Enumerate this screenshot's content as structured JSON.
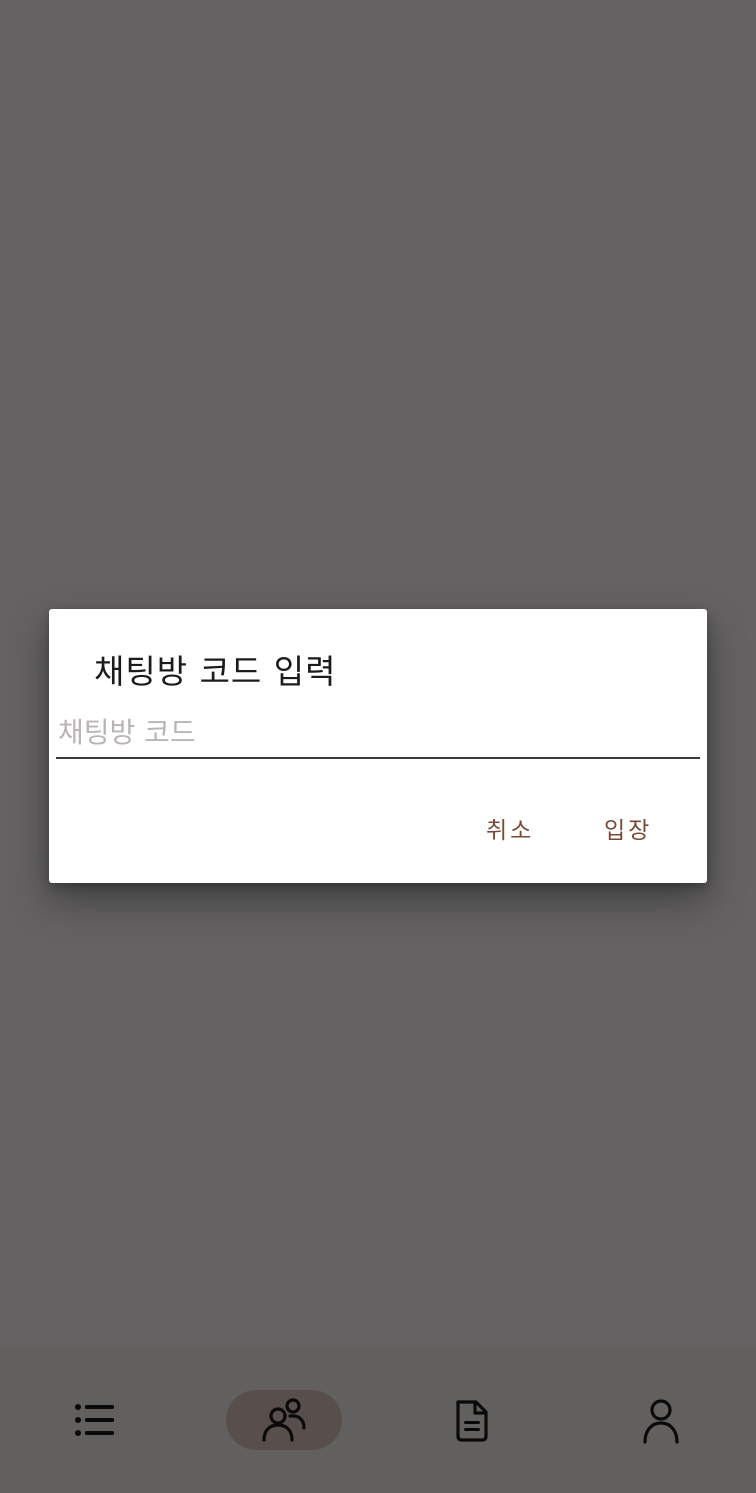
{
  "bottom_nav": {
    "items": [
      {
        "icon": "list-icon",
        "active": false
      },
      {
        "icon": "people-icon",
        "active": true
      },
      {
        "icon": "document-icon",
        "active": false
      },
      {
        "icon": "person-icon",
        "active": false
      }
    ]
  },
  "dialog": {
    "title": "채팅방 코드 입력",
    "input": {
      "value": "",
      "placeholder": "채팅방 코드"
    },
    "cancel_label": "취소",
    "enter_label": "입장"
  },
  "colors": {
    "accent": "#7b4a37",
    "nav_active_pill": "#dcc6bf",
    "scrim": "rgba(0,0,0,0.6)"
  }
}
